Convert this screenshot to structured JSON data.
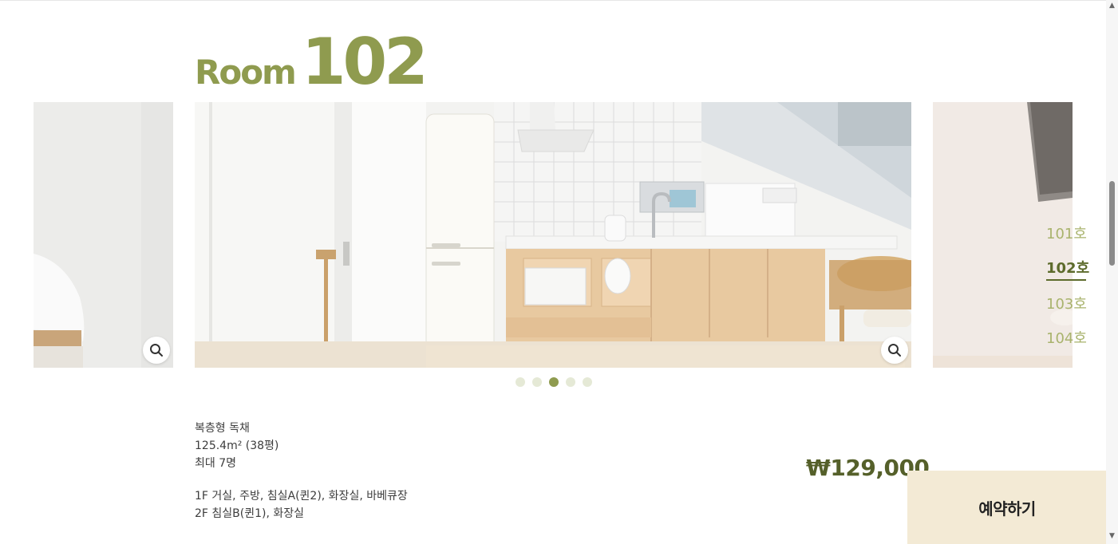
{
  "title": {
    "word": "Room",
    "number": "102"
  },
  "slider": {
    "zoom_icon": "search-icon",
    "dots_count": 5,
    "active_dot_index": 2
  },
  "room_nav": [
    {
      "label": "101호",
      "active": false
    },
    {
      "label": "102호",
      "active": true
    },
    {
      "label": "103호",
      "active": false
    },
    {
      "label": "104호",
      "active": false
    }
  ],
  "info": {
    "type": "복층형 독채",
    "area": "125.4m² (38평)",
    "capacity": "최대 7명",
    "floor1": "1F 거실, 주방, 침실A(퀸2), 화장실, 바베큐장",
    "floor2": "2F 침실B(퀸1), 화장실"
  },
  "price": "₩129,000",
  "reserve_button": "예약하기",
  "colors": {
    "accent": "#8f9b4f",
    "accent_dark": "#5d6b2c",
    "button_bg": "#f3ead5"
  }
}
